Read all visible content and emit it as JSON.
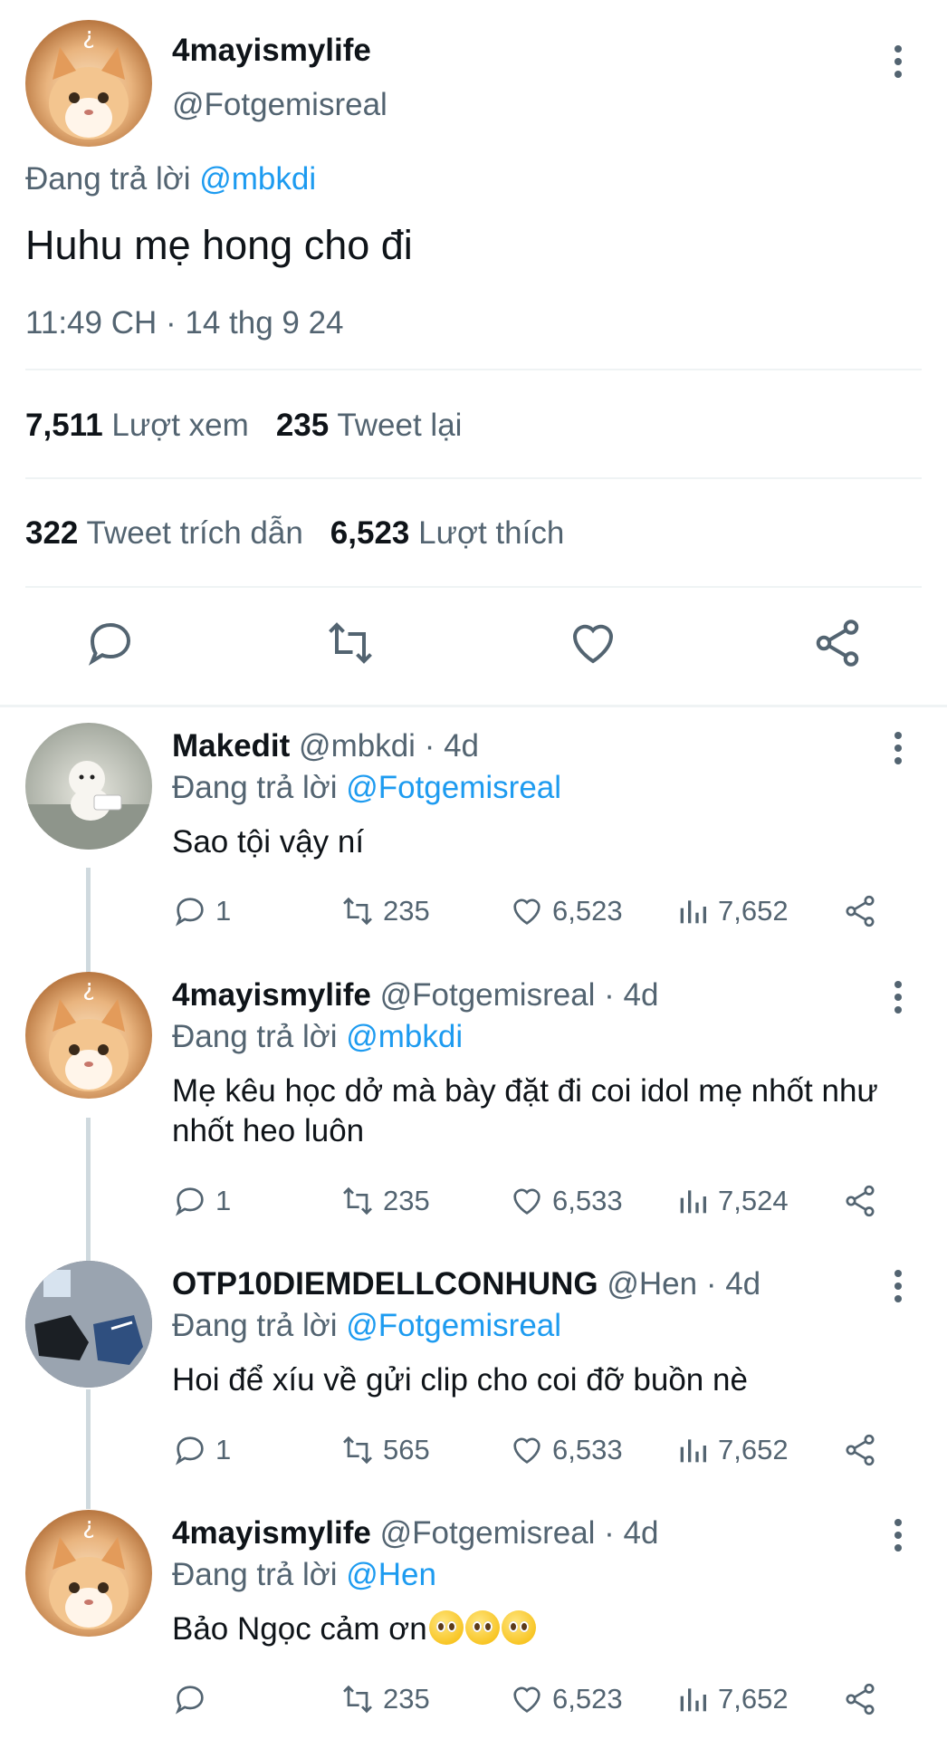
{
  "main_tweet": {
    "display_name": "4mayismylife",
    "handle": "@Fotgemisreal",
    "reply_prefix": "Đang trả lời",
    "reply_to": "@mbkdi",
    "text": "Huhu mẹ hong cho đi",
    "timestamp": "11:49 CH · 14 thg 9 24",
    "views_count": "7,511",
    "views_label": "Lượt xem",
    "retweets_count": "235",
    "retweets_label": "Tweet lại",
    "quotes_count": "322",
    "quotes_label": "Tweet trích dẫn",
    "likes_count": "6,523",
    "likes_label": "Lượt thích",
    "actions": [
      "reply-icon",
      "retweet-icon",
      "like-icon",
      "share-icon"
    ]
  },
  "replies": [
    {
      "display_name": "Makedit",
      "handle": "@mbkdi",
      "time": "· 4d",
      "reply_prefix": "Đang trả lời",
      "reply_to": "@Fotgemisreal",
      "text": "Sao tội vậy ní",
      "replies": "1",
      "retweets": "235",
      "likes": "6,523",
      "views": "7,652",
      "avatar": "white-puppy"
    },
    {
      "display_name": "4mayismylife",
      "handle": "@Fotgemisreal",
      "time": "· 4d",
      "reply_prefix": "Đang trả lời",
      "reply_to": "@mbkdi",
      "text": "Mẹ kêu học dở mà bày đặt đi coi idol mẹ nhốt như nhốt heo luôn",
      "replies": "1",
      "retweets": "235",
      "likes": "6,533",
      "views": "7,524",
      "avatar": "orange-cat"
    },
    {
      "display_name": "OTP10DIEMDELLCONHUNG",
      "handle": "@Hen",
      "time": "· 4d",
      "reply_prefix": "Đang trả lời",
      "reply_to": "@Fotgemisreal",
      "text": "Hoi để xíu về gửi clip cho coi đỡ buồn nè",
      "replies": "1",
      "retweets": "565",
      "likes": "6,533",
      "views": "7,652",
      "avatar": "sneakers"
    },
    {
      "display_name": "4mayismylife",
      "handle": "@Fotgemisreal",
      "time": "· 4d",
      "reply_prefix": "Đang trả lời",
      "reply_to": "@Hen",
      "text": "Bảo Ngọc cảm ơn",
      "emoji": "pleading-face-emoji x3",
      "replies": "",
      "retweets": "235",
      "likes": "6,523",
      "views": "7,652",
      "avatar": "orange-cat"
    }
  ],
  "colors": {
    "link": "#1d9bf0",
    "muted": "#536471",
    "text": "#0f1419",
    "separator": "#eff3f4"
  }
}
